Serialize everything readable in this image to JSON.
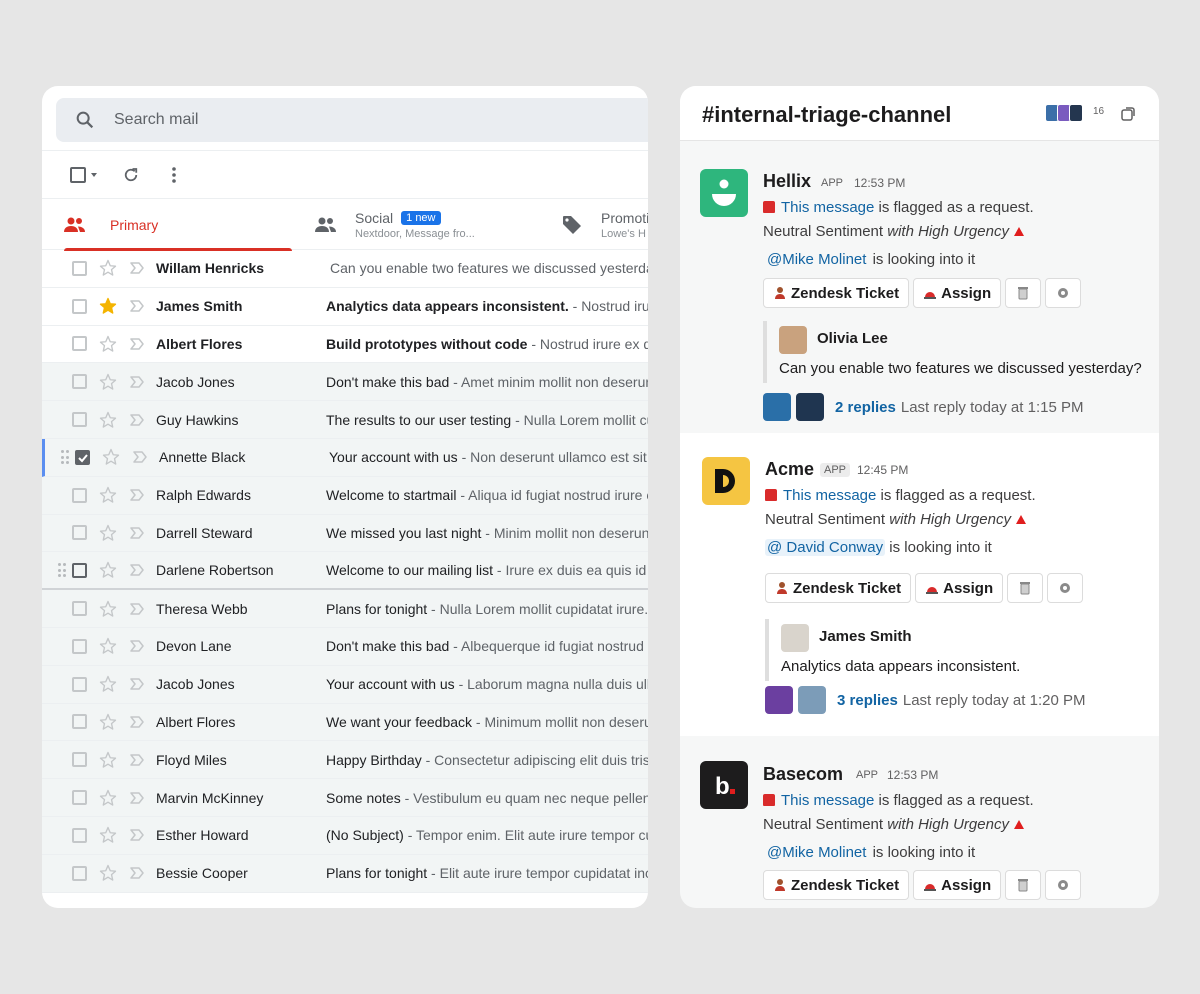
{
  "gmail": {
    "search_placeholder": "Search mail",
    "tabs": [
      {
        "label": "Primary"
      },
      {
        "label": "Social",
        "badge": "1 new",
        "sub": "Nextdoor, Message fro..."
      },
      {
        "label": "Promoti",
        "sub": "Lowe's H"
      }
    ],
    "emails": [
      {
        "from": "Willam Henricks",
        "subject": "",
        "snippet": "Can you enable two features we discussed yesterday",
        "unread": true,
        "starred": false
      },
      {
        "from": "James Smith",
        "subject": "Analytics data appears inconsistent.",
        "snippet": " - Nostrud irure e",
        "unread": true,
        "starred": true
      },
      {
        "from": "Albert Flores",
        "subject": "Build prototypes without code",
        "snippet": " - Nostrud irure ex duis",
        "unread": true,
        "starred": false
      },
      {
        "from": "Jacob Jones",
        "subject": "Don't make this bad",
        "snippet": " - Amet minim mollit non deserun",
        "unread": false,
        "starred": false
      },
      {
        "from": "Guy Hawkins",
        "subject": "The results to our user testing",
        "snippet": " - Nulla Lorem mollit cu",
        "unread": false,
        "starred": false
      },
      {
        "from": "Annette Black",
        "subject": "Your account with us",
        "snippet": " - Non deserunt ullamco est sit a",
        "unread": false,
        "starred": false,
        "selected": true
      },
      {
        "from": "Ralph Edwards",
        "subject": "Welcome to startmail",
        "snippet": " - Aliqua id fugiat nostrud irure e",
        "unread": false,
        "starred": false
      },
      {
        "from": "Darrell Steward",
        "subject": "We missed you last night",
        "snippet": " - Minim mollit non deserunt",
        "unread": false,
        "starred": false
      },
      {
        "from": "Darlene Robertson",
        "subject": "Welcome to our mailing list",
        "snippet": " - Irure ex duis ea quis id q",
        "unread": false,
        "starred": false,
        "hover": true
      },
      {
        "from": "Theresa Webb",
        "subject": "Plans for tonight",
        "snippet": " - Nulla Lorem mollit cupidatat irure.",
        "unread": false,
        "starred": false
      },
      {
        "from": "Devon Lane",
        "subject": "Don't make this bad",
        "snippet": " - Albequerque id fugiat nostrud ir",
        "unread": false,
        "starred": false
      },
      {
        "from": "Jacob Jones",
        "subject": "Your account with us",
        "snippet": " - Laborum magna nulla duis ulla",
        "unread": false,
        "starred": false
      },
      {
        "from": "Albert Flores",
        "subject": "We want your feedback",
        "snippet": " - Minimum mollit non deserun",
        "unread": false,
        "starred": false
      },
      {
        "from": "Floyd Miles",
        "subject": "Happy Birthday",
        "snippet": " - Consectetur adipiscing elit duis trist",
        "unread": false,
        "starred": false
      },
      {
        "from": "Marvin McKinney",
        "subject": "Some notes",
        "snippet": " - Vestibulum eu quam nec neque pellente",
        "unread": false,
        "starred": false
      },
      {
        "from": "Esther Howard",
        "subject": "(No Subject)",
        "snippet": " - Tempor enim. Elit aute irure tempor cup",
        "unread": false,
        "starred": false
      },
      {
        "from": "Bessie Cooper",
        "subject": "Plans for tonight",
        "snippet": " - Elit aute irure tempor cupidatat incid",
        "unread": false,
        "starred": false
      }
    ]
  },
  "slack": {
    "channel": "#internal-triage-channel",
    "member_count": "16",
    "messages": [
      {
        "app": "Hellix",
        "tag": "APP",
        "time": "12:53 PM",
        "link": "This message",
        "flag_text": " is flagged as a request.",
        "sentiment": "Neutral Sentiment ",
        "urgency": "with High Urgency",
        "mention": "@Mike Molinet",
        "mention_suffix": " is looking into it",
        "buttons": [
          "Zendesk Ticket",
          "Assign"
        ],
        "quote_name": "Olivia Lee",
        "quote_text": "Can you enable two features we discussed yesterday?",
        "replies": "2 replies",
        "last_reply": "Last reply today at 1:15 PM"
      },
      {
        "app": "Acme",
        "tag": "APP",
        "time": "12:45 PM",
        "link": "This message",
        "flag_text": " is flagged as a request.",
        "sentiment": "Neutral Sentiment ",
        "urgency": "with High Urgency",
        "mention": "@ David Conway",
        "mention_suffix": "  is looking into it",
        "buttons": [
          "Zendesk Ticket",
          "Assign"
        ],
        "quote_name": "James Smith",
        "quote_text": "Analytics data appears inconsistent.",
        "replies": "3 replies",
        "last_reply": "Last reply today at 1:20 PM"
      },
      {
        "app": "Basecom",
        "tag": "APP",
        "time": "12:53 PM",
        "link": "This message",
        "flag_text": " is flagged as a request.",
        "sentiment": "Neutral Sentiment ",
        "urgency": "with High Urgency",
        "mention": "@Mike Molinet",
        "mention_suffix": " is looking into it",
        "buttons": [
          "Zendesk Ticket",
          "Assign"
        ]
      }
    ]
  },
  "colors": {
    "gmail_red": "#d93025",
    "slack_link": "#1264a3",
    "hellix_green": "#2eb67d",
    "acme_yellow": "#f5c542",
    "basecom_dark": "#1d1c1d"
  }
}
